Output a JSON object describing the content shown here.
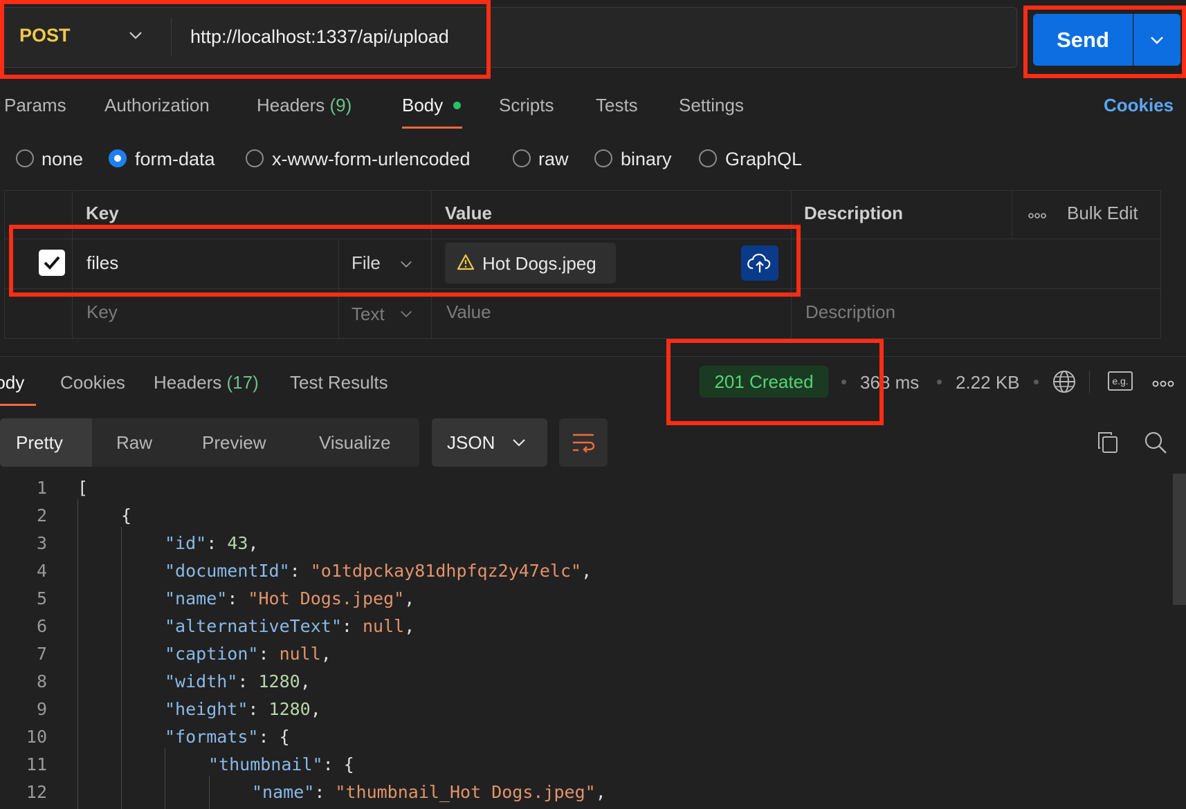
{
  "request": {
    "method": "POST",
    "url": "http://localhost:1337/api/upload",
    "send_label": "Send"
  },
  "request_tabs": {
    "params": "Params",
    "authorization": "Authorization",
    "headers": "Headers",
    "headers_count": "(9)",
    "body": "Body",
    "scripts": "Scripts",
    "tests": "Tests",
    "settings": "Settings",
    "cookies": "Cookies"
  },
  "body_types": {
    "none": "none",
    "form_data": "form-data",
    "urlencoded": "x-www-form-urlencoded",
    "raw": "raw",
    "binary": "binary",
    "graphql": "GraphQL",
    "selected": "form-data"
  },
  "form_table": {
    "headers": {
      "key": "Key",
      "value": "Value",
      "description": "Description",
      "bulk_edit": "Bulk Edit"
    },
    "row": {
      "checked": true,
      "key": "files",
      "type": "File",
      "value": "Hot Dogs.jpeg"
    },
    "new_row": {
      "key_placeholder": "Key",
      "type": "Text",
      "value_placeholder": "Value",
      "description_placeholder": "Description"
    }
  },
  "response_tabs": {
    "body": "Body",
    "cookies": "Cookies",
    "headers": "Headers",
    "headers_count": "(17)",
    "test_results": "Test Results"
  },
  "response_meta": {
    "status": "201 Created",
    "time": "368 ms",
    "size": "2.22 KB",
    "example_label": "e.g."
  },
  "view_modes": {
    "pretty": "Pretty",
    "raw": "Raw",
    "preview": "Preview",
    "visualize": "Visualize",
    "format": "JSON"
  },
  "code_lines": [
    {
      "n": "1",
      "key": "",
      "val": "",
      "open": "[",
      "close": ""
    },
    {
      "n": "2",
      "key": "",
      "val": "",
      "open": "{",
      "close": ""
    },
    {
      "n": "3",
      "key": "\"id\"",
      "val": "43",
      "open": "",
      "close": ","
    },
    {
      "n": "4",
      "key": "\"documentId\"",
      "val": "\"o1tdpckay81dhpfqz2y47elc\"",
      "open": "",
      "close": ","
    },
    {
      "n": "5",
      "key": "\"name\"",
      "val": "\"Hot Dogs.jpeg\"",
      "open": "",
      "close": ","
    },
    {
      "n": "6",
      "key": "\"alternativeText\"",
      "val": "null",
      "open": "",
      "close": ","
    },
    {
      "n": "7",
      "key": "\"caption\"",
      "val": "null",
      "open": "",
      "close": ","
    },
    {
      "n": "8",
      "key": "\"width\"",
      "val": "1280",
      "open": "",
      "close": ","
    },
    {
      "n": "9",
      "key": "\"height\"",
      "val": "1280",
      "open": "",
      "close": ","
    },
    {
      "n": "10",
      "key": "\"formats\"",
      "val": "",
      "open": "{",
      "close": ""
    },
    {
      "n": "11",
      "key": "\"thumbnail\"",
      "val": "",
      "open": "{",
      "close": ""
    },
    {
      "n": "12",
      "key": "\"name\"",
      "val": "\"thumbnail_Hot Dogs.jpeg\"",
      "open": "",
      "close": ","
    }
  ],
  "colors": {
    "accent": "#0d6ee2",
    "highlight": "#ff2d15",
    "status_ok": "#58d17a",
    "method": "#f2c94c"
  }
}
